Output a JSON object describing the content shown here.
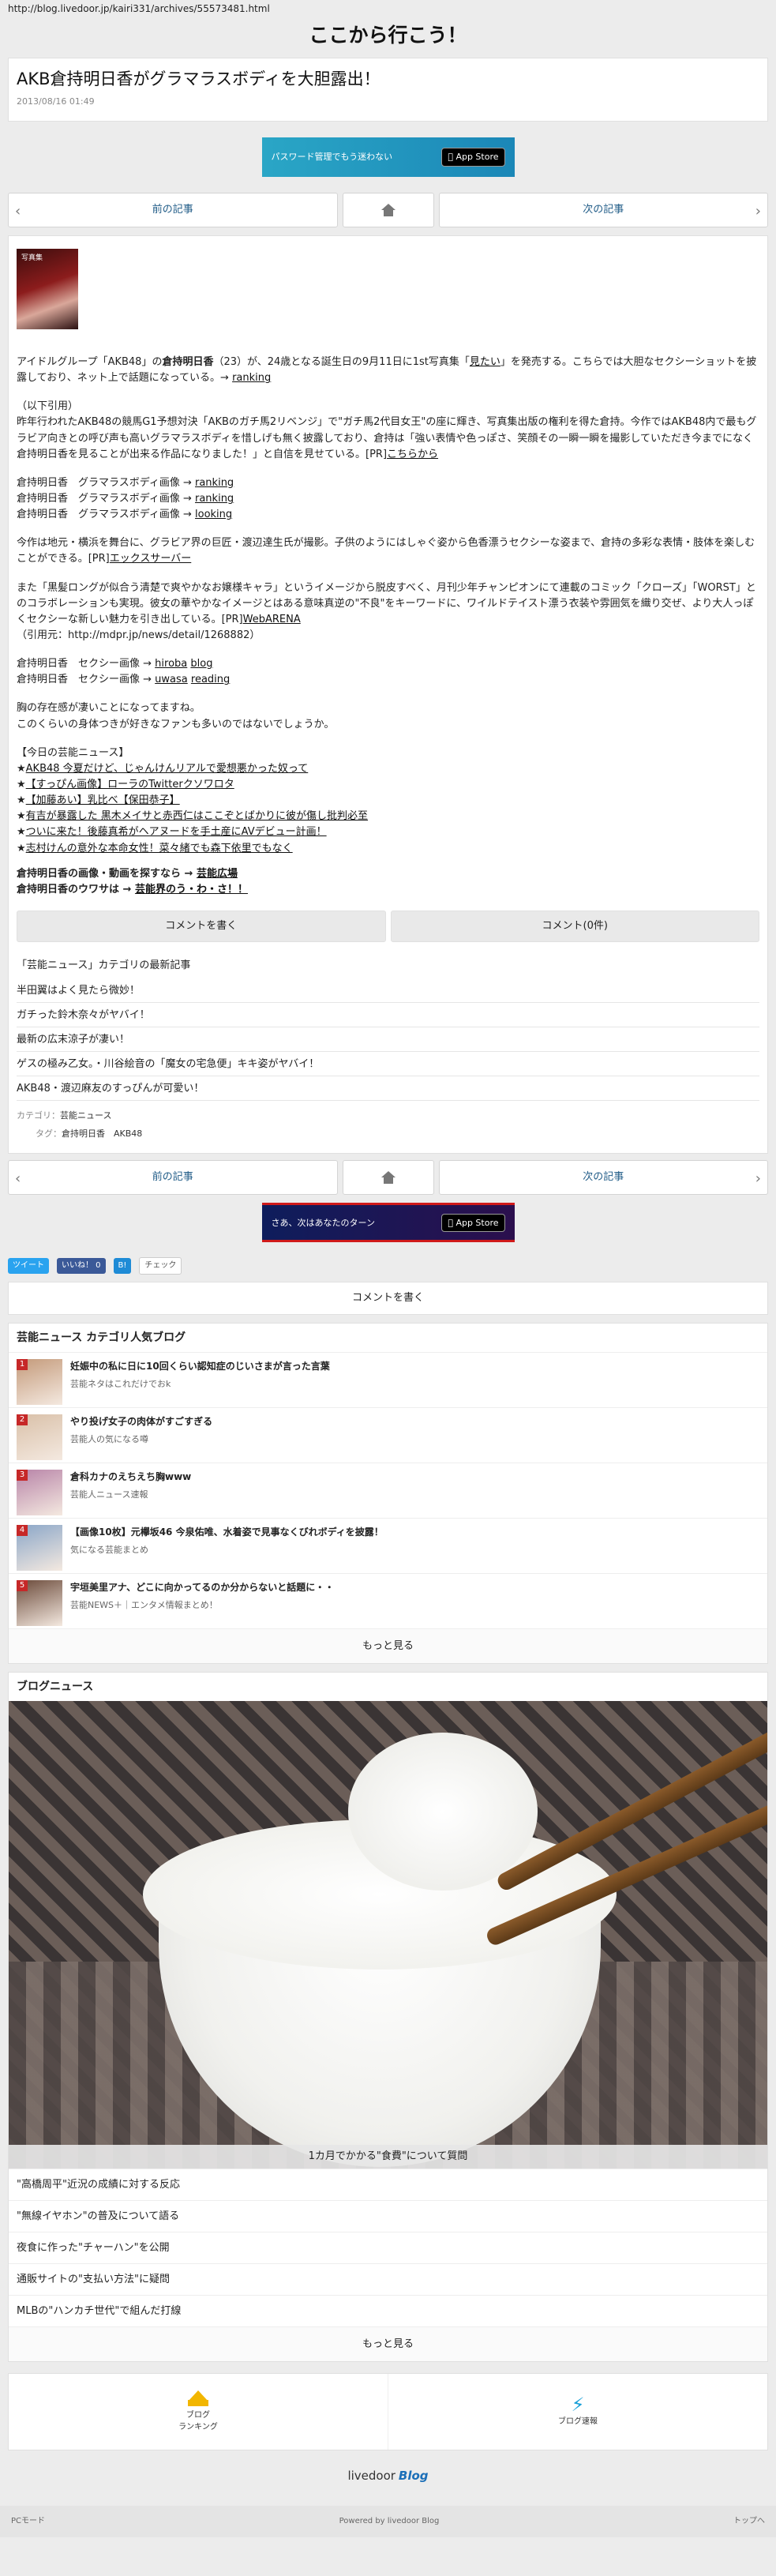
{
  "url": "http://blog.livedoor.jp/kairi331/archives/55573481.html",
  "site_title": "ここから行こう！",
  "article": {
    "title": "AKB倉持明日香がグラマラスボディを大胆露出！",
    "date": "2013/08/16 01:49",
    "thumb_label": "写真集",
    "p1": {
      "a": "アイドルグループ「AKB48」の",
      "b": "倉持明日香",
      "c": "（23）が、24歳となる誕生日の9月11日に1st写真集「",
      "link1": "見たい",
      "d": "」を発売する。こちらでは大胆なセクシーショットを披露しており、ネット上で話題になっている。→ ",
      "link2": "ranking"
    },
    "p2": {
      "a": "（以下引用）\n昨年行われたAKB48の競馬G1予想対決「AKBのガチ馬2リベンジ」で\"ガチ馬2代目女王\"の座に輝き、写真集出版の権利を得た倉持。今作ではAKB48内で最もグラビア向きとの呼び声も高いグラマラスボディを惜しげも無く披露しており、倉持は「強い表情や色っぽさ、笑顔その一瞬一瞬を撮影していただき今までになく倉持明日香を見ることが出来る作品になりました！」と自信を見せている。[PR]",
      "link": "こちらから"
    },
    "lines1": [
      {
        "label": "倉持明日香　グラマラスボディ画像 → ",
        "link": "ranking"
      },
      {
        "label": "倉持明日香　グラマラスボディ画像 → ",
        "link": "ranking"
      },
      {
        "label": "倉持明日香　グラマラスボディ画像 → ",
        "link": "looking"
      }
    ],
    "p3": {
      "a": "今作は地元・横浜を舞台に、グラビア界の巨匠・渡辺達生氏が撮影。子供のようにはしゃぐ姿から色香漂うセクシーな姿まで、倉持の多彩な表情・肢体を楽しむことができる。[PR]",
      "link": "エックスサーバー"
    },
    "p4": {
      "a": "また「黒髪ロングが似合う清楚で爽やかなお嬢様キャラ」というイメージから脱皮すべく、月刊少年チャンピオンにて連載のコミック「クローズ」「WORST」とのコラボレーションも実現。彼女の華やかなイメージとはある意味真逆の\"不良\"をキーワードに、ワイルドテイスト漂う衣装や雰囲気を織り交ぜ、より大人っぽくセクシーな新しい魅力を引き出している。[PR]",
      "link": "WebARENA",
      "b": "（引用元：http://mdpr.jp/news/detail/1268882）"
    },
    "lines2": [
      {
        "label": "倉持明日香　セクシー画像 → ",
        "link1": "hiroba",
        "link2": "blog"
      },
      {
        "label": "倉持明日香　セクシー画像 → ",
        "link1": "uwasa",
        "link2": "reading"
      }
    ],
    "p5": "胸の存在感が凄いことになってますね。\nこのくらいの身体つきが好きなファンも多いのではないでしょうか。",
    "today_header": "【今日の芸能ニュース】",
    "today_items": [
      "AKB48 今夏だけど、じゃんけんリアルで愛想悪かった奴って",
      "【すっぴん画像】ローラのTwitterクソワロタ",
      "【加藤あい】乳比べ【保田恭子】",
      "有吉が暴露した 黒木メイサと赤西仁はここぞとばかりに彼が傷し批判必至",
      "ついに来た！後藤真希がヘアヌードを手土産にAVデビュー計画！",
      "志村けんの意外な本命女性！菜々緒でも森下依里でもなく"
    ],
    "footer_lines": [
      {
        "label": "倉持明日香の画像・動画を探すなら → ",
        "link": "芸能広場"
      },
      {
        "label": "倉持明日香のウワサは → ",
        "link": "芸能界のう・わ・さ！！"
      }
    ]
  },
  "pager": {
    "prev": "前の記事",
    "next": "次の記事"
  },
  "ads": {
    "ad1_text": "パスワード管理でもう迷わない",
    "ad2_text": "さあ、次はあなたのターン",
    "appstore": "App Store"
  },
  "buttons": {
    "write_comment": "コメントを書く",
    "comments": "コメント(0件)"
  },
  "recent": {
    "title": "「芸能ニュース」カテゴリの最新記事",
    "items": [
      "半田翼はよく見たら微妙！",
      "ガチった鈴木奈々がヤバイ！",
      "最新の広末涼子が凄い！",
      "ゲスの極み乙女。・川谷絵音の「魔女の宅急便」キキ姿がヤバイ！",
      "AKB48・渡辺麻友のすっぴんが可愛い！"
    ]
  },
  "meta": {
    "category_label": "カテゴリ：",
    "category": "芸能ニュース",
    "tag_label": "タグ：",
    "tags": "倉持明日香　AKB48"
  },
  "share": {
    "tweet": "ツイート",
    "like": "いいね！ 0",
    "hatena": "B!",
    "check": "チェック"
  },
  "write_comment_2": "コメントを書く",
  "popular": {
    "title": "芸能ニュース カテゴリ人気ブログ",
    "items": [
      {
        "num": "1",
        "title": "妊娠中の私に日に10回くらい認知症のじいさまが言った言葉",
        "src": "芸能ネタはこれだけでおk",
        "color": "#c49a7a"
      },
      {
        "num": "2",
        "title": "やり投げ女子の肉体がすごすぎる",
        "src": "芸能人の気になる噂",
        "color": "#d9c0a8"
      },
      {
        "num": "3",
        "title": "倉科カナのえちえち胸www",
        "src": "芸能人ニュース速報",
        "color": "#b884a8"
      },
      {
        "num": "4",
        "title": "【画像10枚】元欅坂46 今泉佑唯、水着姿で見事なくびれボディを披露！",
        "src": "気になる芸能まとめ",
        "color": "#8aa6c8"
      },
      {
        "num": "5",
        "title": "宇垣美里アナ、どこに向かってるのか分からないと話題に・・",
        "src": "芸能NEWS＋｜エンタメ情報まとめ！",
        "color": "#6b4a3a"
      }
    ],
    "more": "もっと見る"
  },
  "blog_news": {
    "title": "ブログニュース",
    "caption": "1カ月でかかる\"食費\"について質問",
    "items": [
      "\"高橋周平\"近況の成績に対する反応",
      "\"無線イヤホン\"の普及について語る",
      "夜食に作った\"チャーハン\"を公開",
      "通販サイトの\"支払い方法\"に疑問",
      "MLBの\"ハンカチ世代\"で組んだ打線"
    ],
    "more": "もっと見る"
  },
  "footer_nav": {
    "ranking_l1": "ブログ",
    "ranking_l2": "ランキング",
    "bulletin": "ブログ速報"
  },
  "footer_logo": {
    "livedoor": "livedoor",
    "blog": "Blog"
  },
  "footer_bar": {
    "pc_mode": "PCモード",
    "powered": "Powered by livedoor Blog",
    "top": "トップへ"
  },
  "colors": {
    "link": "#225d88",
    "rank_badge": "#c62828",
    "background": "#ececec"
  }
}
